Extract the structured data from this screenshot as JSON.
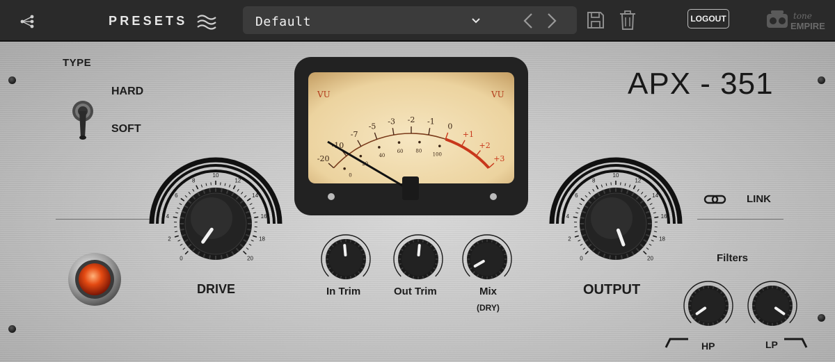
{
  "topbar": {
    "presets_label": "PRESETS",
    "preset_name": "Default",
    "logout_label": "LOGOUT",
    "brand_line1": "tone",
    "brand_line2": "EMPIRE"
  },
  "panel": {
    "model_title": "APX - 351",
    "type_label": "TYPE",
    "type_options": [
      "HARD",
      "SOFT"
    ],
    "type_selected": "SOFT",
    "drive": {
      "label": "DRIVE",
      "scale": [
        "0",
        "2",
        "4",
        "6",
        "8",
        "10",
        "12",
        "14",
        "16",
        "18",
        "20"
      ]
    },
    "output": {
      "label": "OUTPUT",
      "scale": [
        "0",
        "2",
        "4",
        "6",
        "8",
        "10",
        "12",
        "14",
        "16",
        "18",
        "20"
      ]
    },
    "in_trim_label": "In Trim",
    "out_trim_label": "Out Trim",
    "mix_label": "Mix",
    "mix_sub_label": "(DRY)",
    "link_label": "LINK",
    "filters_label": "Filters",
    "hp_label": "HP",
    "lp_label": "LP",
    "vu": {
      "left_tag": "VU",
      "right_tag": "VU",
      "db_scale": [
        "-20",
        "-10",
        "-7",
        "-5",
        "-3",
        "-2",
        "-1",
        "0",
        "+1",
        "+2",
        "+3"
      ],
      "pct_scale": [
        "0",
        "20",
        "40",
        "60",
        "80",
        "100"
      ]
    }
  },
  "colors": {
    "vu_face": "#f1dcae",
    "vu_red": "#c8371b",
    "lamp": "#e44a12",
    "topbar": "#2a2a2a"
  }
}
